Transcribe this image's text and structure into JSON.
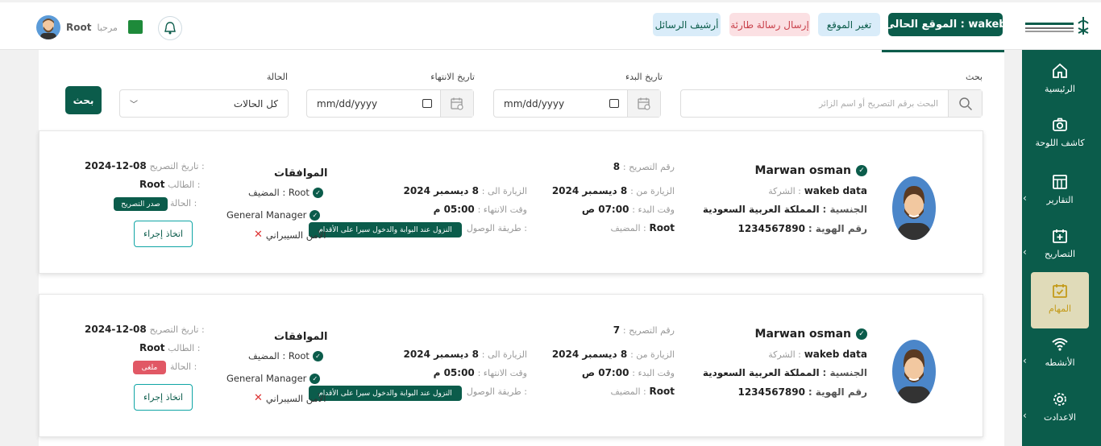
{
  "topbar": {
    "greeting": "مرحبا",
    "username": "Root",
    "current_site_label": "الموقع الحالى : wakeb",
    "change_site": "تغير الموقع",
    "send_urgent": "إرسال رسالة طارئة",
    "archive_messages": "أرشيف الرسائل"
  },
  "sidebar": {
    "items": [
      {
        "label": "الرئيسية",
        "icon": "home-icon"
      },
      {
        "label": "كاشف اللوحة",
        "icon": "camera-icon"
      },
      {
        "label": "التقارير",
        "icon": "reports-icon"
      },
      {
        "label": "التصاريح",
        "icon": "calendar-plus-icon"
      },
      {
        "label": "المهام",
        "icon": "calendar-check-icon",
        "active": true
      },
      {
        "label": "الأنشطه",
        "icon": "wifi-icon"
      },
      {
        "label": "الاعدادت",
        "icon": "gear-icon"
      }
    ]
  },
  "filters": {
    "search_label": "بحث",
    "search_placeholder": "البحث برقم التصريح أو اسم الزائر",
    "start_label": "تاريخ البدء",
    "end_label": "تاريخ الانتهاء",
    "date_value": "mm/dd/yyyy",
    "status_label": "الحالة",
    "status_value": "كل الحالات",
    "search_button": "بحث"
  },
  "labels": {
    "permit_no": "رقم التصريح :",
    "company": "الشركة :",
    "nationality": "الجنسية :",
    "id_no": "رقم الهوية :",
    "visit_from": "الزيارة من :",
    "visit_to": "الزيارة الى :",
    "start_time": "وقت البدء :",
    "end_time": "وقت الانتهاء :",
    "host": "المضيف :",
    "arrival": "طريقة الوصول :",
    "approvals": "الموافقات",
    "permit_date": "تاريخ التصريح :",
    "requester": "الطالب :",
    "status": "الحالة :",
    "take_action": "اتخاذ إجراء"
  },
  "cards": [
    {
      "name": "Marwan osman",
      "permit_no": "8",
      "company": "wakeb data",
      "nationality": "المملكة العربية السعودية",
      "id_no": "1234567890",
      "visit_from": "8 ديسمبر 2024",
      "visit_to": "8 ديسمبر 2024",
      "start_time": "07:00 ص",
      "end_time": "05:00 م",
      "host": "Root",
      "arrival_tip": "النزول عند البوابة والدخول سيرا على الأقدام",
      "approval_host": "المضيف : Root",
      "approval_gm": "General Manager",
      "approval_cyber": "الأمن السيبراني",
      "permit_date": "2024-12-08",
      "requester": "Root",
      "status_badge": "صدر التصريح"
    },
    {
      "name": "Marwan osman",
      "permit_no": "7",
      "company": "wakeb data",
      "nationality": "المملكة العربية السعودية",
      "id_no": "1234567890",
      "visit_from": "8 ديسمبر 2024",
      "visit_to": "8 ديسمبر 2024",
      "start_time": "07:00 ص",
      "end_time": "05:00 م",
      "host": "Root",
      "arrival_tip": "النزول عند البوابة والدخول سيرا على الأقدام",
      "approval_host": "المضيف : Root",
      "approval_gm": "General Manager",
      "approval_cyber": "الأمن السيبراني",
      "permit_date": "2024-12-08",
      "requester": "Root",
      "status_badge": "ملغى"
    }
  ],
  "colors": {
    "primary": "#0b5c4b",
    "active_nav_bg": "#e0dbb9",
    "active_nav_text": "#c49b1a",
    "danger": "#e15865"
  }
}
